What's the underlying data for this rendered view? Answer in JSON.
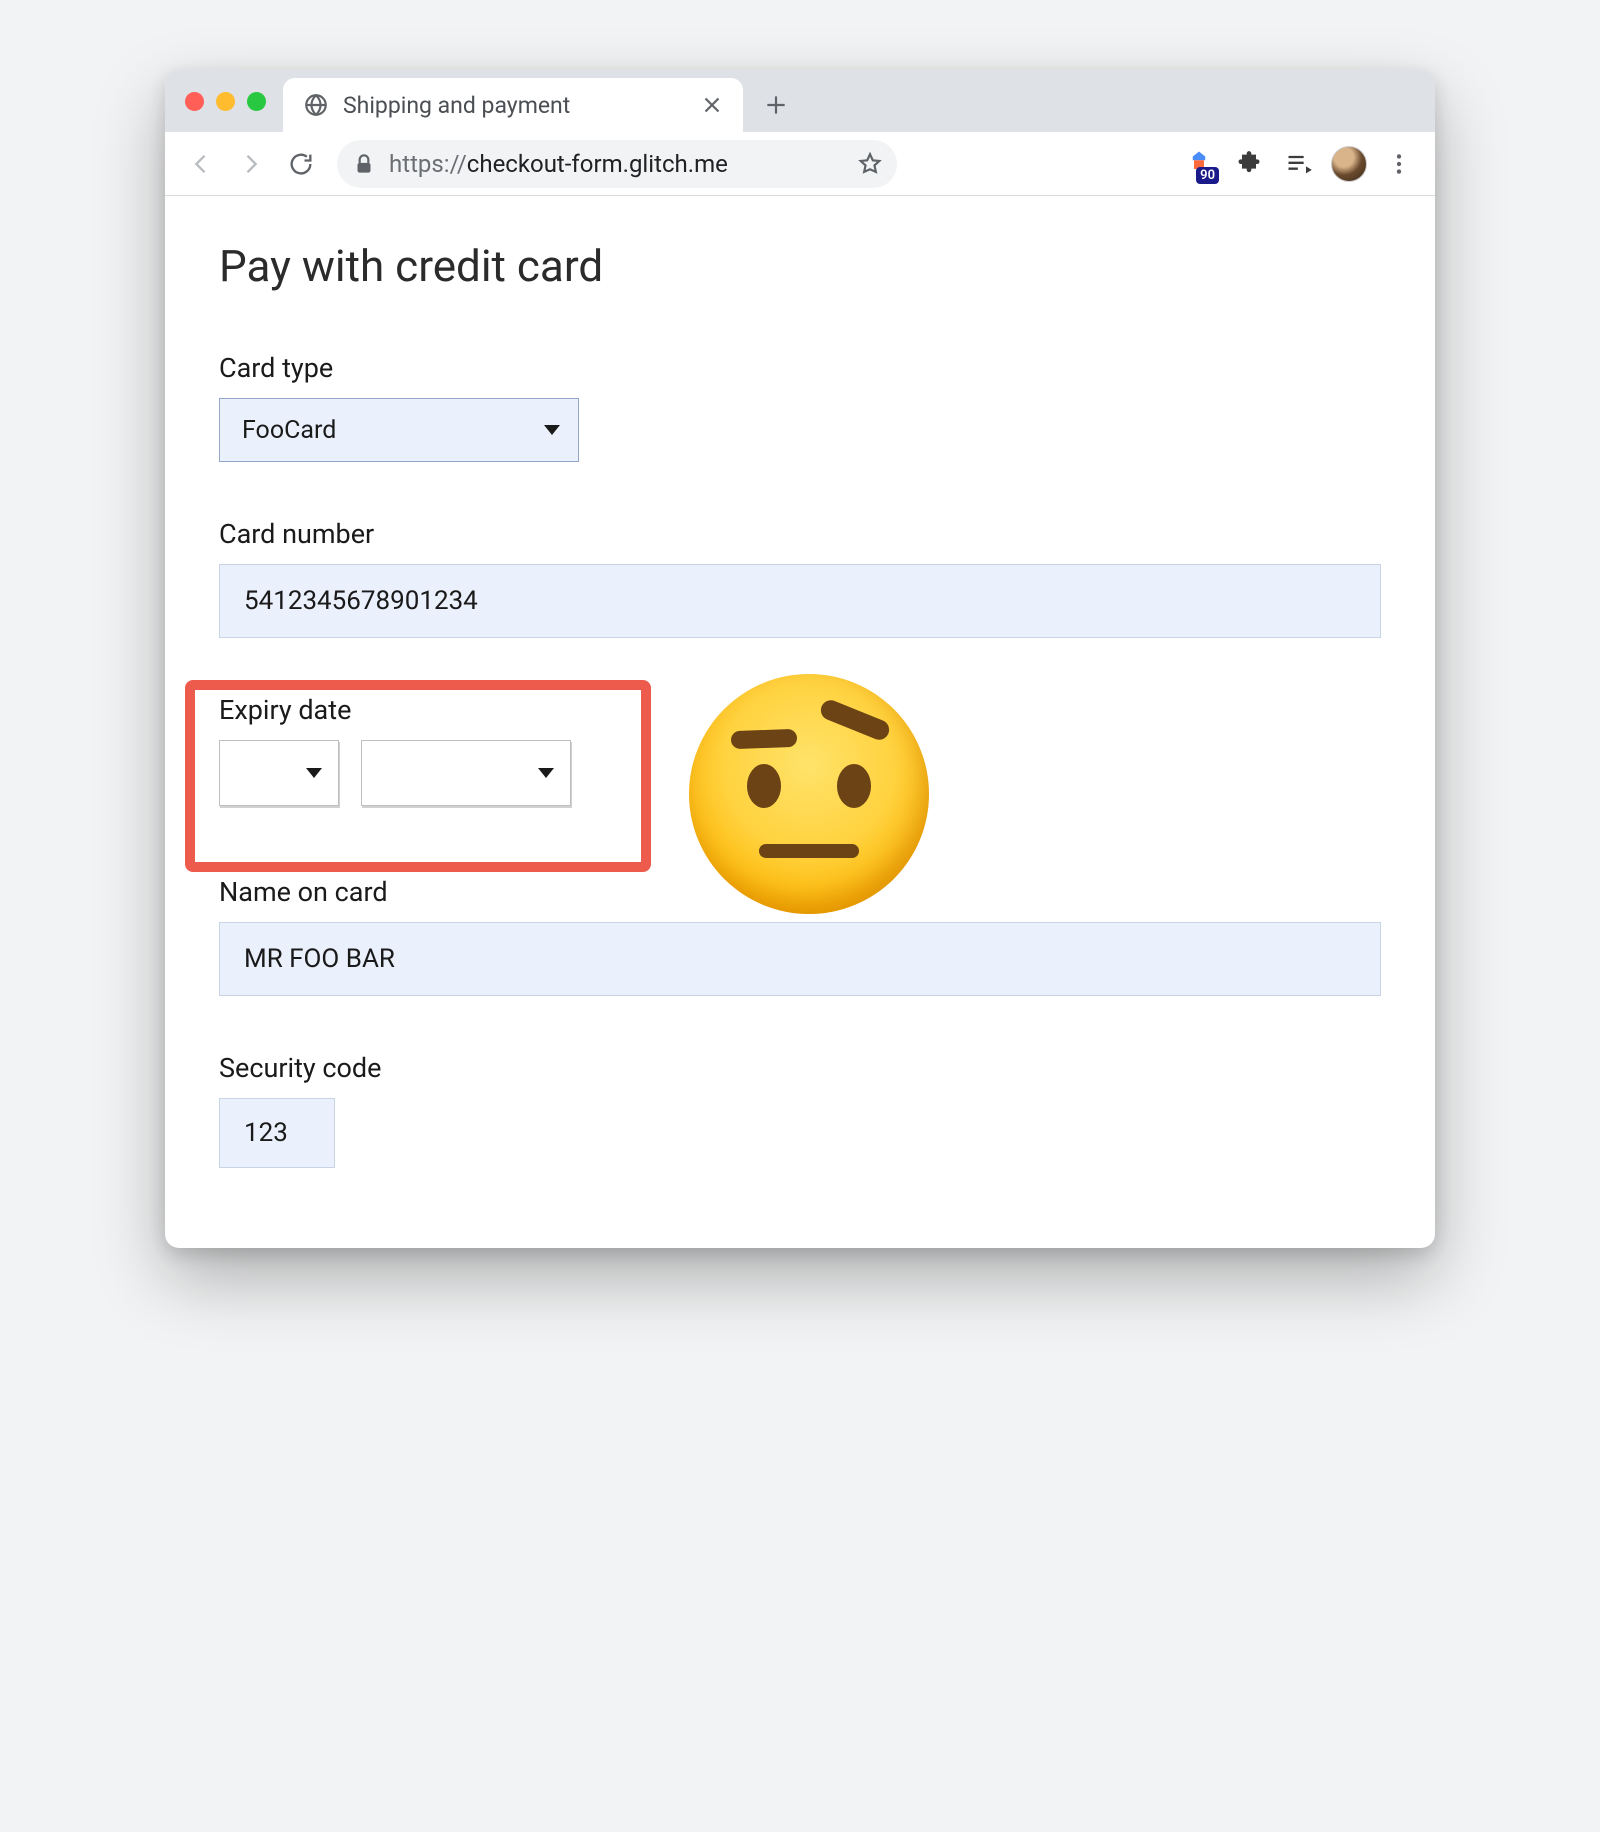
{
  "browser": {
    "tab_title": "Shipping and payment",
    "url_scheme": "https://",
    "url_host": "checkout-form.glitch.me",
    "lighthouse_badge": "90"
  },
  "page": {
    "heading": "Pay with credit card",
    "card_type": {
      "label": "Card type",
      "value": "FooCard"
    },
    "card_number": {
      "label": "Card number",
      "value": "5412345678901234"
    },
    "expiry": {
      "label": "Expiry date",
      "month_value": "",
      "year_value": ""
    },
    "name_on_card": {
      "label": "Name on card",
      "value": "MR FOO BAR"
    },
    "security_code": {
      "label": "Security code",
      "value": "123"
    }
  },
  "icons": {
    "globe": "globe-icon",
    "close": "close-icon",
    "plus": "plus-icon",
    "back": "back-icon",
    "forward": "forward-icon",
    "reload": "reload-icon",
    "lock": "lock-icon",
    "star": "star-icon",
    "lighthouse": "lighthouse-icon",
    "puzzle": "puzzle-icon",
    "playlist": "playlist-icon",
    "menu": "menu-dots-icon"
  },
  "annotation": {
    "highlight_color": "#ed5b4d",
    "emoji": "raised-eyebrow-face"
  }
}
